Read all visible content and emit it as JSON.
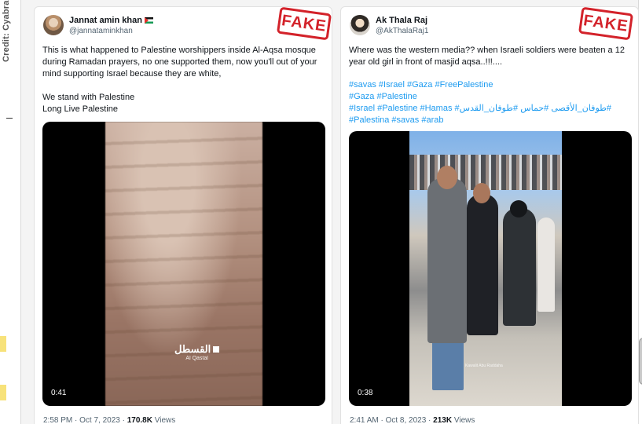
{
  "credit": "Credit: Cyabra",
  "tweets": [
    {
      "name": "Jannat amin khan",
      "handle": "@jannataminkhan",
      "label": "FAKE",
      "text": "This is what happened to Palestine worshippers inside Al-Aqsa mosque during Ramadan prayers, no one supported them, now you'll out of your mind supporting Israel because they are white,\n\nWe stand with Palestine\nLong Live Palestine",
      "video_watermark": "القسطل",
      "video_watermark_sub": "Al Qastal",
      "duration": "0:41",
      "time": "2:58 PM · Oct 7, 2023 · ",
      "views_count": "170.8K",
      "views_label": " Views"
    },
    {
      "name": "Ak Thala Raj",
      "handle": "@AkThalaRaj1",
      "label": "FAKE",
      "text": "Where was the western media?? when Israeli soldiers were beaten a 12 year old girl in front of masjid aqsa..!!!....",
      "hashtags": [
        "#savas #Israel #Gaza #FreePalestine",
        "#Gaza #Palestine",
        "#Israel #Palestine #Hamas #طوفان_الأقصى #حماس #طوفان_القدس#",
        "#Palestina #savas #arab"
      ],
      "video_caption": "Kawalit Abu Raddaha",
      "duration": "0:38",
      "time": "2:41 AM · Oct 8, 2023 · ",
      "views_count": "213K",
      "views_label": " Views"
    }
  ],
  "colors": {
    "stamp": "#d3222a",
    "link": "#1d9bf0",
    "muted": "#536471"
  },
  "icons": [
    "palestine-flag-icon"
  ]
}
